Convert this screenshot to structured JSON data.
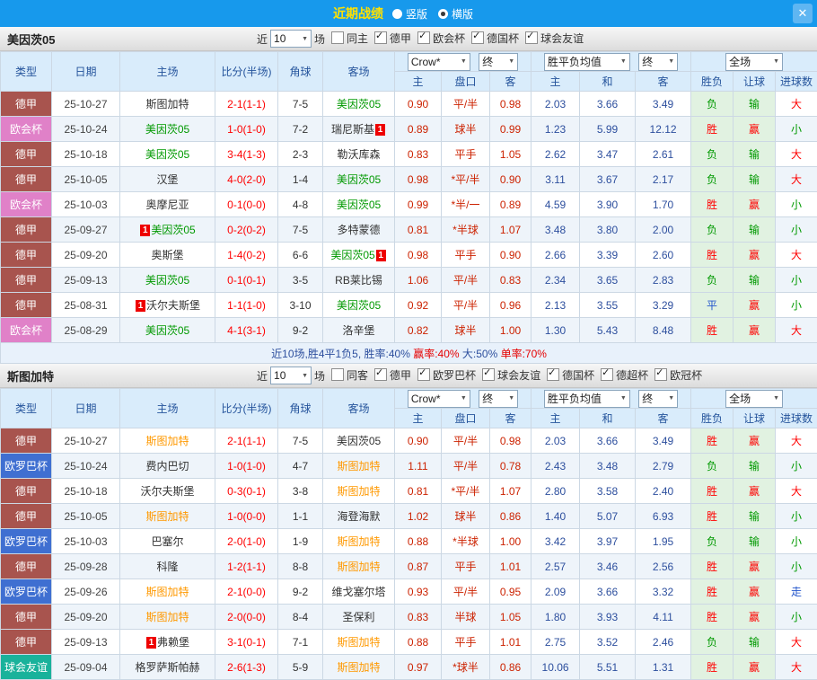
{
  "topbar": {
    "title": "近期战绩",
    "options": [
      {
        "label": "竖版",
        "selected": false
      },
      {
        "label": "横版",
        "selected": true
      }
    ],
    "close_label": "✕"
  },
  "filters_common": {
    "near": "近",
    "count": "10",
    "games": "场"
  },
  "header": {
    "type": "类型",
    "date": "日期",
    "home": "主场",
    "score": "比分(半场)",
    "corner": "角球",
    "away": "客场",
    "odds_source": "Crow*",
    "final": "终",
    "avg": "胜平负均值",
    "full": "全场",
    "ah_home": "主",
    "ah_pk": "盘口",
    "ah_away": "客",
    "eu_home": "主",
    "eu_draw": "和",
    "eu_away": "客",
    "res_wdl": "胜负",
    "res_handicap": "让球",
    "res_goals": "进球数"
  },
  "maps": {
    "league_colors": {
      "德甲": "#a8544e",
      "欧会杯": "#e081c8",
      "欧罗巴杯": "#3f6fd1",
      "球会友谊": "#19b29b"
    },
    "hl_colors": {
      "green": "#009900",
      "orange": "#ff9900"
    },
    "result_colors": {
      "胜": "#ff0000",
      "负": "#009900",
      "平": "#2255cc",
      "赢": "#ff0000",
      "输": "#009900",
      "走": "#2255cc",
      "大": "#ff0000",
      "小": "#009900"
    },
    "text_colors": {
      "score": "#ff0000",
      "corner": "#333333",
      "date": "#444444",
      "ah": "#cc2200",
      "eu": "#2d4f9e"
    }
  },
  "table1": {
    "team": "美因茨05",
    "filters": [
      {
        "label": "同主",
        "checked": false
      },
      {
        "label": "德甲",
        "checked": true
      },
      {
        "label": "欧会杯",
        "checked": true
      },
      {
        "label": "德国杯",
        "checked": true
      },
      {
        "label": "球会友谊",
        "checked": true
      }
    ],
    "rows": [
      {
        "league": "德甲",
        "date": "25-10-27",
        "home": {
          "n": "斯图加特"
        },
        "score": "2-1(1-1)",
        "corner": "7-5",
        "away": {
          "n": "美因茨05",
          "hl": "green"
        },
        "ah": [
          "0.90",
          "平/半",
          "0.98"
        ],
        "eu": [
          "2.03",
          "3.66",
          "3.49"
        ],
        "res": [
          "负",
          "输",
          "大"
        ]
      },
      {
        "league": "欧会杯",
        "date": "25-10-24",
        "home": {
          "n": "美因茨05",
          "hl": "green"
        },
        "score": "1-0(1-0)",
        "corner": "7-2",
        "away": {
          "n": "瑞尼斯基",
          "card": "post"
        },
        "ah": [
          "0.89",
          "球半",
          "0.99"
        ],
        "eu": [
          "1.23",
          "5.99",
          "12.12"
        ],
        "res": [
          "胜",
          "赢",
          "小"
        ]
      },
      {
        "league": "德甲",
        "date": "25-10-18",
        "home": {
          "n": "美因茨05",
          "hl": "green"
        },
        "score": "3-4(1-3)",
        "corner": "2-3",
        "away": {
          "n": "勒沃库森"
        },
        "ah": [
          "0.83",
          "平手",
          "1.05"
        ],
        "eu": [
          "2.62",
          "3.47",
          "2.61"
        ],
        "res": [
          "负",
          "输",
          "大"
        ]
      },
      {
        "league": "德甲",
        "date": "25-10-05",
        "home": {
          "n": "汉堡"
        },
        "score": "4-0(2-0)",
        "corner": "1-4",
        "away": {
          "n": "美因茨05",
          "hl": "green"
        },
        "ah": [
          "0.98",
          "*平/半",
          "0.90"
        ],
        "eu": [
          "3.11",
          "3.67",
          "2.17"
        ],
        "res": [
          "负",
          "输",
          "大"
        ]
      },
      {
        "league": "欧会杯",
        "date": "25-10-03",
        "home": {
          "n": "奥摩尼亚"
        },
        "score": "0-1(0-0)",
        "corner": "4-8",
        "away": {
          "n": "美因茨05",
          "hl": "green"
        },
        "ah": [
          "0.99",
          "*半/一",
          "0.89"
        ],
        "eu": [
          "4.59",
          "3.90",
          "1.70"
        ],
        "res": [
          "胜",
          "赢",
          "小"
        ]
      },
      {
        "league": "德甲",
        "date": "25-09-27",
        "home": {
          "n": "美因茨05",
          "hl": "green",
          "card": "pre"
        },
        "score": "0-2(0-2)",
        "corner": "7-5",
        "away": {
          "n": "多特蒙德"
        },
        "ah": [
          "0.81",
          "*半球",
          "1.07"
        ],
        "eu": [
          "3.48",
          "3.80",
          "2.00"
        ],
        "res": [
          "负",
          "输",
          "小"
        ]
      },
      {
        "league": "德甲",
        "date": "25-09-20",
        "home": {
          "n": "奥斯堡"
        },
        "score": "1-4(0-2)",
        "corner": "6-6",
        "away": {
          "n": "美因茨05",
          "hl": "green",
          "card": "post"
        },
        "ah": [
          "0.98",
          "平手",
          "0.90"
        ],
        "eu": [
          "2.66",
          "3.39",
          "2.60"
        ],
        "res": [
          "胜",
          "赢",
          "大"
        ]
      },
      {
        "league": "德甲",
        "date": "25-09-13",
        "home": {
          "n": "美因茨05",
          "hl": "green"
        },
        "score": "0-1(0-1)",
        "corner": "3-5",
        "away": {
          "n": "RB莱比锡"
        },
        "ah": [
          "1.06",
          "平/半",
          "0.83"
        ],
        "eu": [
          "2.34",
          "3.65",
          "2.83"
        ],
        "res": [
          "负",
          "输",
          "小"
        ]
      },
      {
        "league": "德甲",
        "date": "25-08-31",
        "home": {
          "n": "沃尔夫斯堡",
          "card": "pre"
        },
        "score": "1-1(1-0)",
        "corner": "3-10",
        "away": {
          "n": "美因茨05",
          "hl": "green"
        },
        "ah": [
          "0.92",
          "平/半",
          "0.96"
        ],
        "eu": [
          "2.13",
          "3.55",
          "3.29"
        ],
        "res": [
          "平",
          "赢",
          "小"
        ]
      },
      {
        "league": "欧会杯",
        "date": "25-08-29",
        "home": {
          "n": "美因茨05",
          "hl": "green"
        },
        "score": "4-1(3-1)",
        "corner": "9-2",
        "away": {
          "n": "洛辛堡"
        },
        "ah": [
          "0.82",
          "球半",
          "1.00"
        ],
        "eu": [
          "1.30",
          "5.43",
          "8.48"
        ],
        "res": [
          "胜",
          "赢",
          "大"
        ]
      }
    ],
    "summary": [
      {
        "t": "近10场,胜4平1负5, 胜率:40%",
        "c": "#2d4f9e"
      },
      {
        "t": " 赢率:40%",
        "c": "#e60000"
      },
      {
        "t": " 大:50%",
        "c": "#2d4f9e"
      },
      {
        "t": " 单率:70%",
        "c": "#e60000"
      }
    ]
  },
  "table2": {
    "team": "斯图加特",
    "filters": [
      {
        "label": "同客",
        "checked": false
      },
      {
        "label": "德甲",
        "checked": true
      },
      {
        "label": "欧罗巴杯",
        "checked": true
      },
      {
        "label": "球会友谊",
        "checked": true
      },
      {
        "label": "德国杯",
        "checked": true
      },
      {
        "label": "德超杯",
        "checked": true
      },
      {
        "label": "欧冠杯",
        "checked": true
      }
    ],
    "rows": [
      {
        "league": "德甲",
        "date": "25-10-27",
        "home": {
          "n": "斯图加特",
          "hl": "orange"
        },
        "score": "2-1(1-1)",
        "corner": "7-5",
        "away": {
          "n": "美因茨05"
        },
        "ah": [
          "0.90",
          "平/半",
          "0.98"
        ],
        "eu": [
          "2.03",
          "3.66",
          "3.49"
        ],
        "res": [
          "胜",
          "赢",
          "大"
        ]
      },
      {
        "league": "欧罗巴杯",
        "date": "25-10-24",
        "home": {
          "n": "费内巴切"
        },
        "score": "1-0(1-0)",
        "corner": "4-7",
        "away": {
          "n": "斯图加特",
          "hl": "orange"
        },
        "ah": [
          "1.11",
          "平/半",
          "0.78"
        ],
        "eu": [
          "2.43",
          "3.48",
          "2.79"
        ],
        "res": [
          "负",
          "输",
          "小"
        ]
      },
      {
        "league": "德甲",
        "date": "25-10-18",
        "home": {
          "n": "沃尔夫斯堡"
        },
        "score": "0-3(0-1)",
        "corner": "3-8",
        "away": {
          "n": "斯图加特",
          "hl": "orange"
        },
        "ah": [
          "0.81",
          "*平/半",
          "1.07"
        ],
        "eu": [
          "2.80",
          "3.58",
          "2.40"
        ],
        "res": [
          "胜",
          "赢",
          "大"
        ]
      },
      {
        "league": "德甲",
        "date": "25-10-05",
        "home": {
          "n": "斯图加特",
          "hl": "orange"
        },
        "score": "1-0(0-0)",
        "corner": "1-1",
        "away": {
          "n": "海登海默"
        },
        "ah": [
          "1.02",
          "球半",
          "0.86"
        ],
        "eu": [
          "1.40",
          "5.07",
          "6.93"
        ],
        "res": [
          "胜",
          "输",
          "小"
        ]
      },
      {
        "league": "欧罗巴杯",
        "date": "25-10-03",
        "home": {
          "n": "巴塞尔"
        },
        "score": "2-0(1-0)",
        "corner": "1-9",
        "away": {
          "n": "斯图加特",
          "hl": "orange"
        },
        "ah": [
          "0.88",
          "*半球",
          "1.00"
        ],
        "eu": [
          "3.42",
          "3.97",
          "1.95"
        ],
        "res": [
          "负",
          "输",
          "小"
        ]
      },
      {
        "league": "德甲",
        "date": "25-09-28",
        "home": {
          "n": "科隆"
        },
        "score": "1-2(1-1)",
        "corner": "8-8",
        "away": {
          "n": "斯图加特",
          "hl": "orange"
        },
        "ah": [
          "0.87",
          "平手",
          "1.01"
        ],
        "eu": [
          "2.57",
          "3.46",
          "2.56"
        ],
        "res": [
          "胜",
          "赢",
          "小"
        ]
      },
      {
        "league": "欧罗巴杯",
        "date": "25-09-26",
        "home": {
          "n": "斯图加特",
          "hl": "orange"
        },
        "score": "2-1(0-0)",
        "corner": "9-2",
        "away": {
          "n": "维戈塞尔塔"
        },
        "ah": [
          "0.93",
          "平/半",
          "0.95"
        ],
        "eu": [
          "2.09",
          "3.66",
          "3.32"
        ],
        "res": [
          "胜",
          "赢",
          "走"
        ]
      },
      {
        "league": "德甲",
        "date": "25-09-20",
        "home": {
          "n": "斯图加特",
          "hl": "orange"
        },
        "score": "2-0(0-0)",
        "corner": "8-4",
        "away": {
          "n": "圣保利"
        },
        "ah": [
          "0.83",
          "半球",
          "1.05"
        ],
        "eu": [
          "1.80",
          "3.93",
          "4.11"
        ],
        "res": [
          "胜",
          "赢",
          "小"
        ]
      },
      {
        "league": "德甲",
        "date": "25-09-13",
        "home": {
          "n": "弗赖堡",
          "card": "pre"
        },
        "score": "3-1(0-1)",
        "corner": "7-1",
        "away": {
          "n": "斯图加特",
          "hl": "orange"
        },
        "ah": [
          "0.88",
          "平手",
          "1.01"
        ],
        "eu": [
          "2.75",
          "3.52",
          "2.46"
        ],
        "res": [
          "负",
          "输",
          "大"
        ]
      },
      {
        "league": "球会友谊",
        "date": "25-09-04",
        "home": {
          "n": "格罗萨斯帕赫"
        },
        "score": "2-6(1-3)",
        "corner": "5-9",
        "away": {
          "n": "斯图加特",
          "hl": "orange"
        },
        "ah": [
          "0.97",
          "*球半",
          "0.86"
        ],
        "eu": [
          "10.06",
          "5.51",
          "1.31"
        ],
        "res": [
          "胜",
          "赢",
          "大"
        ]
      }
    ]
  }
}
